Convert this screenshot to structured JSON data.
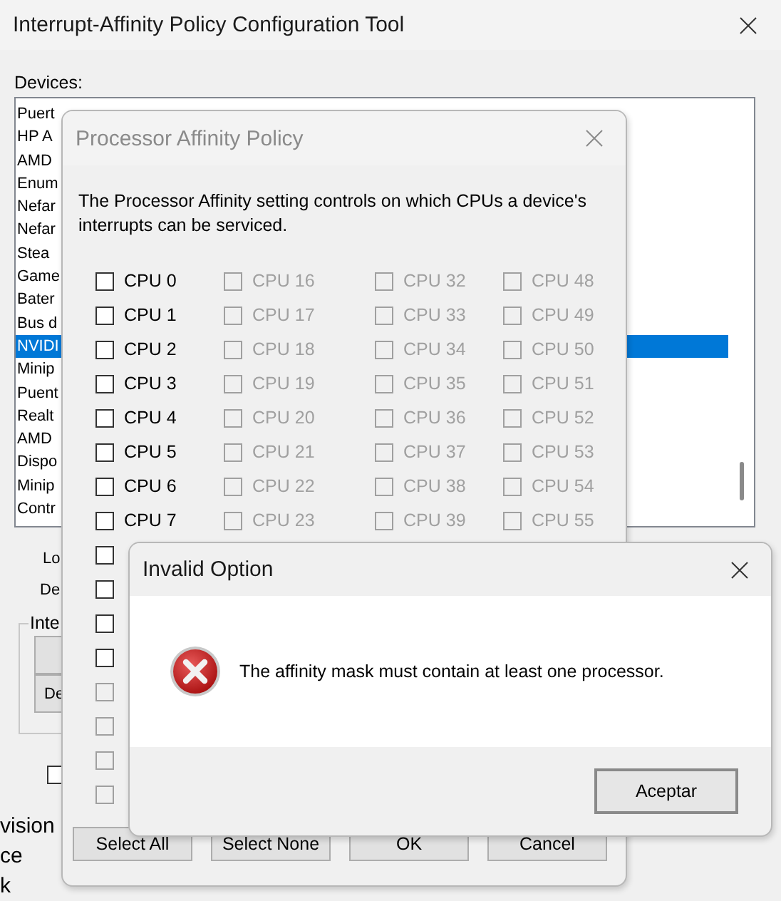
{
  "main_window": {
    "title": "Interrupt-Affinity Policy Configuration Tool",
    "devices_label": "Devices:",
    "devices": [
      {
        "name": "Puert",
        "selected": false
      },
      {
        "name": "HP A",
        "selected": false
      },
      {
        "name": "AMD",
        "selected": false
      },
      {
        "name": "Enum",
        "selected": false
      },
      {
        "name": "Nefar",
        "selected": false
      },
      {
        "name": "Nefar",
        "selected": false
      },
      {
        "name": "Stea",
        "selected": false
      },
      {
        "name": "Game",
        "selected": false
      },
      {
        "name": "Bater",
        "selected": false
      },
      {
        "name": "Bus d",
        "selected": false
      },
      {
        "name": "NVIDI",
        "selected": true
      },
      {
        "name": "Minip",
        "selected": false
      },
      {
        "name": "Puent",
        "selected": false
      },
      {
        "name": "Realt",
        "selected": false
      },
      {
        "name": "AMD",
        "selected": false
      },
      {
        "name": "Dispo",
        "selected": false
      },
      {
        "name": "Minip",
        "selected": false
      },
      {
        "name": "Contr",
        "selected": false
      }
    ],
    "labels": [
      "Lo",
      "De"
    ],
    "group": {
      "title": "Inte",
      "buttons": [
        "De"
      ]
    },
    "option_checkbox": {
      "checked": false
    },
    "lower_texts": [
      "vision",
      "ce",
      "k"
    ]
  },
  "affinity_dialog": {
    "title": "Processor Affinity Policy",
    "description": "The Processor Affinity setting controls on which CPUs a device's interrupts can be serviced.",
    "cpu_columns": [
      [
        {
          "label": "CPU 0",
          "checked": false,
          "disabled": false
        },
        {
          "label": "CPU 1",
          "checked": false,
          "disabled": false
        },
        {
          "label": "CPU 2",
          "checked": false,
          "disabled": false
        },
        {
          "label": "CPU 3",
          "checked": false,
          "disabled": false
        },
        {
          "label": "CPU 4",
          "checked": false,
          "disabled": false
        },
        {
          "label": "CPU 5",
          "checked": false,
          "disabled": false
        },
        {
          "label": "CPU 6",
          "checked": false,
          "disabled": false
        },
        {
          "label": "CPU 7",
          "checked": false,
          "disabled": false
        },
        {
          "checked": false,
          "disabled": false
        },
        {
          "checked": false,
          "disabled": false
        },
        {
          "checked": false,
          "disabled": false
        },
        {
          "checked": false,
          "disabled": false
        },
        {
          "checked": false,
          "disabled": true
        },
        {
          "checked": false,
          "disabled": true
        },
        {
          "checked": false,
          "disabled": true
        },
        {
          "checked": false,
          "disabled": true
        }
      ],
      [
        {
          "label": "CPU 16",
          "checked": false,
          "disabled": true
        },
        {
          "label": "CPU 17",
          "checked": false,
          "disabled": true
        },
        {
          "label": "CPU 18",
          "checked": false,
          "disabled": true
        },
        {
          "label": "CPU 19",
          "checked": false,
          "disabled": true
        },
        {
          "label": "CPU 20",
          "checked": false,
          "disabled": true
        },
        {
          "label": "CPU 21",
          "checked": false,
          "disabled": true
        },
        {
          "label": "CPU 22",
          "checked": false,
          "disabled": true
        },
        {
          "label": "CPU 23",
          "checked": false,
          "disabled": true
        }
      ],
      [
        {
          "label": "CPU 32",
          "checked": false,
          "disabled": true
        },
        {
          "label": "CPU 33",
          "checked": false,
          "disabled": true
        },
        {
          "label": "CPU 34",
          "checked": false,
          "disabled": true
        },
        {
          "label": "CPU 35",
          "checked": false,
          "disabled": true
        },
        {
          "label": "CPU 36",
          "checked": false,
          "disabled": true
        },
        {
          "label": "CPU 37",
          "checked": false,
          "disabled": true
        },
        {
          "label": "CPU 38",
          "checked": false,
          "disabled": true
        },
        {
          "label": "CPU 39",
          "checked": false,
          "disabled": true
        }
      ],
      [
        {
          "label": "CPU 48",
          "checked": false,
          "disabled": true
        },
        {
          "label": "CPU 49",
          "checked": false,
          "disabled": true
        },
        {
          "label": "CPU 50",
          "checked": false,
          "disabled": true
        },
        {
          "label": "CPU 51",
          "checked": false,
          "disabled": true
        },
        {
          "label": "CPU 52",
          "checked": false,
          "disabled": true
        },
        {
          "label": "CPU 53",
          "checked": false,
          "disabled": true
        },
        {
          "label": "CPU 54",
          "checked": false,
          "disabled": true
        },
        {
          "label": "CPU 55",
          "checked": false,
          "disabled": true
        }
      ]
    ],
    "buttons": [
      "Select All",
      "Select None",
      "OK",
      "Cancel"
    ]
  },
  "message_box": {
    "title": "Invalid Option",
    "kind": "error",
    "message": "The affinity mask must contain at least one processor.",
    "buttons": [
      "Aceptar"
    ]
  }
}
